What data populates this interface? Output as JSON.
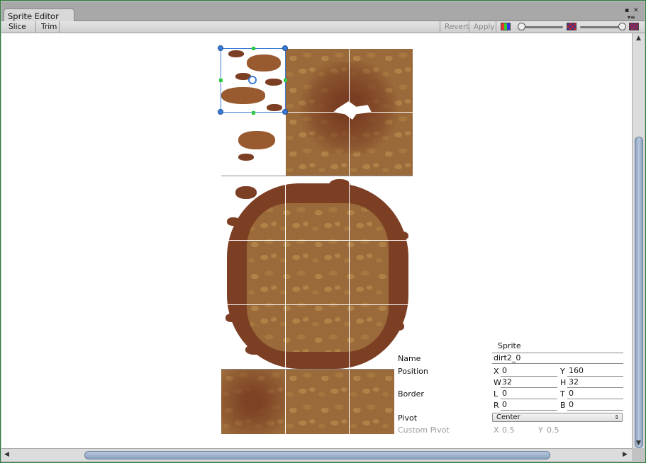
{
  "window": {
    "tab_title": "Sprite Editor",
    "menu_icon": "menu-icon",
    "max_icon": "maximize-icon"
  },
  "toolbar": {
    "slice_label": "Slice",
    "trim_label": "Trim",
    "revert_label": "Revert",
    "apply_label": "Apply"
  },
  "sprite_panel": {
    "header": "Sprite",
    "name_label": "Name",
    "name_value": "dirt2_0",
    "position_label": "Position",
    "x_label": "X",
    "x_value": "0",
    "y_label": "Y",
    "y_value": "160",
    "w_label": "W",
    "w_value": "32",
    "h_label": "H",
    "h_value": "32",
    "border_label": "Border",
    "l_label": "L",
    "l_value": "0",
    "t_label": "T",
    "t_value": "0",
    "r_label": "R",
    "r_value": "0",
    "b_label": "B",
    "b_value": "0",
    "pivot_label": "Pivot",
    "pivot_value": "Center",
    "custom_pivot_label": "Custom Pivot",
    "cx_label": "X",
    "cx_value": "0.5",
    "cy_label": "Y",
    "cy_value": "0.5"
  },
  "colors": {
    "selection": "#3a7bd5",
    "dirt_dark": "#7c3f24",
    "dirt_light": "#9a6a3a"
  }
}
